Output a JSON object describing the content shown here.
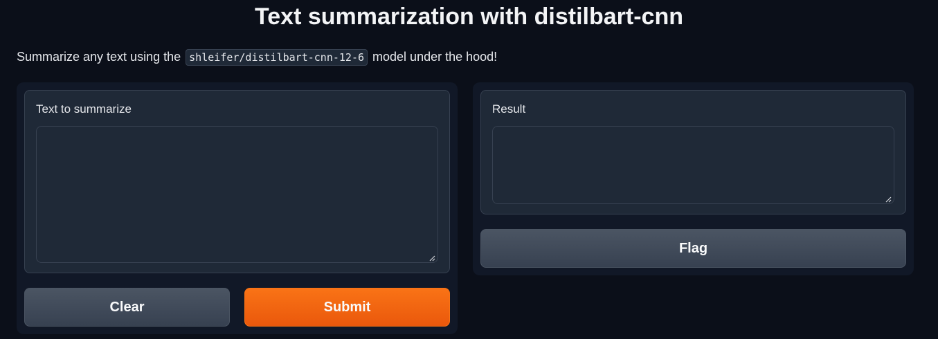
{
  "header": {
    "title": "Text summarization with distilbart-cnn"
  },
  "description": {
    "prefix": "Summarize any text using the",
    "model_code": "shleifer/distilbart-cnn-12-6",
    "suffix": "model under the hood!"
  },
  "input_panel": {
    "label": "Text to summarize",
    "value": "",
    "clear_label": "Clear",
    "submit_label": "Submit"
  },
  "output_panel": {
    "label": "Result",
    "value": "",
    "flag_label": "Flag"
  },
  "colors": {
    "background": "#0b0f19",
    "panel": "#111827",
    "block": "#1f2937",
    "accent": "#f97316",
    "secondary_button": "#4b5563"
  }
}
